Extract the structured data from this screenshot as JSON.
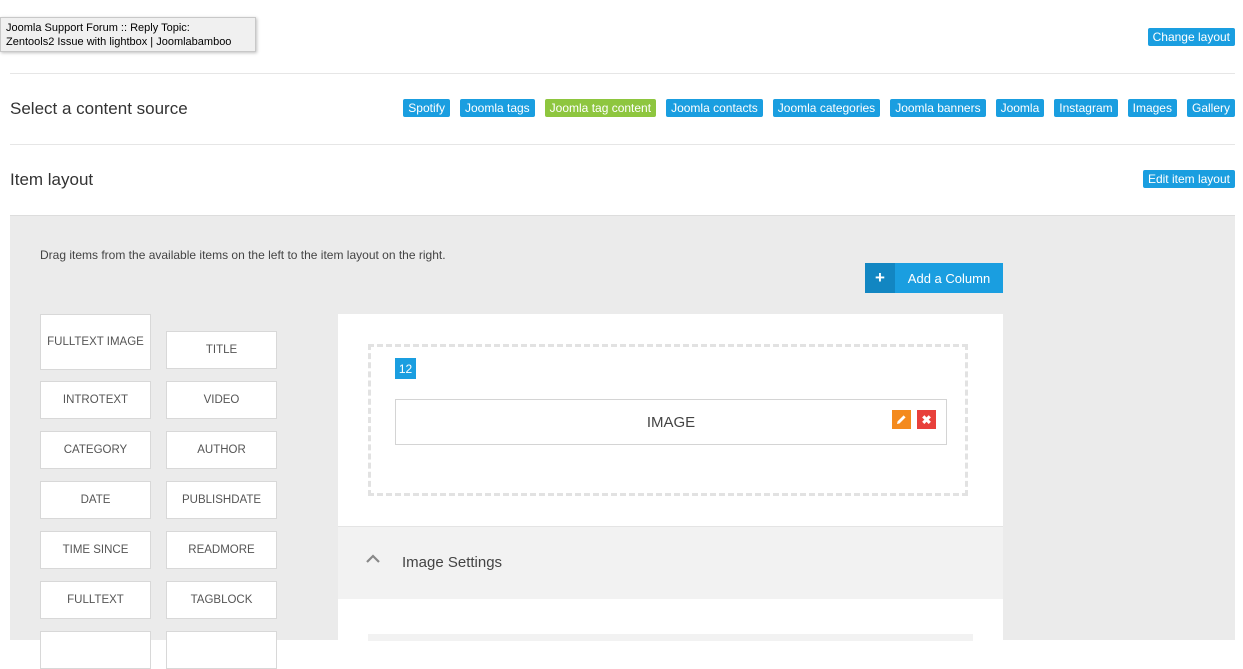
{
  "tooltip": {
    "line1": "Joomla Support Forum :: Reply Topic:",
    "line2": "Zentools2 Issue with lightbox | Joomlabamboo"
  },
  "change_layout_label": "Change layout",
  "content_source": {
    "title": "Select a content source",
    "sources": [
      {
        "label": "Spotify",
        "active": false
      },
      {
        "label": "Joomla tags",
        "active": false
      },
      {
        "label": "Joomla tag content",
        "active": true
      },
      {
        "label": "Joomla contacts",
        "active": false
      },
      {
        "label": "Joomla categories",
        "active": false
      },
      {
        "label": "Joomla banners",
        "active": false
      },
      {
        "label": "Joomla",
        "active": false
      },
      {
        "label": "Instagram",
        "active": false
      },
      {
        "label": "Images",
        "active": false
      },
      {
        "label": "Gallery",
        "active": false
      }
    ]
  },
  "item_layout": {
    "title": "Item layout",
    "edit_label": "Edit item layout",
    "instructions": "Drag items from the available items on the left to the item layout on the right.",
    "add_column_label": "Add a Column",
    "available_items": {
      "left": [
        "FULLTEXT IMAGE",
        "INTROTEXT",
        "CATEGORY",
        "DATE",
        "TIME SINCE",
        "FULLTEXT"
      ],
      "right": [
        "TITLE",
        "VIDEO",
        "AUTHOR",
        "PUBLISHDATE",
        "READMORE",
        "TAGBLOCK"
      ]
    },
    "column_width": "12",
    "placed_item": "IMAGE",
    "settings_title": "Image Settings"
  },
  "colors": {
    "accent": "#1a9ee0",
    "active_source": "#8ec63f",
    "edit": "#f48a1d",
    "delete": "#e8403b"
  }
}
